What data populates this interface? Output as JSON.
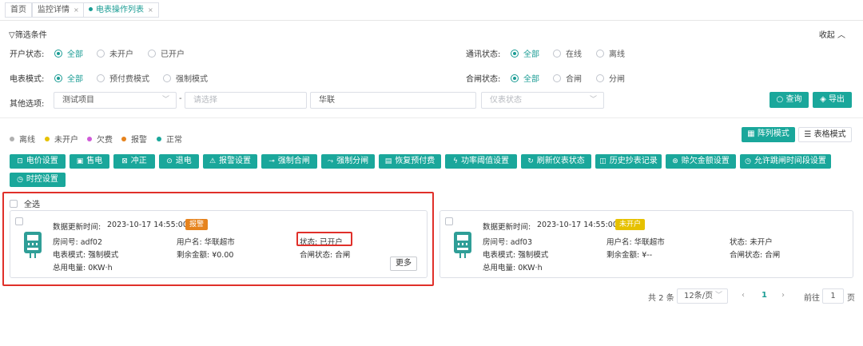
{
  "tabs": [
    {
      "label": "首页"
    },
    {
      "label": "监控详情"
    },
    {
      "label": "电表操作列表"
    }
  ],
  "filter": {
    "title": "筛选条件",
    "collapse_label": "收起",
    "open_status": {
      "label": "开户状态:",
      "options": [
        "全部",
        "未开户",
        "已开户"
      ],
      "selected": "全部"
    },
    "comm_status": {
      "label": "通讯状态:",
      "options": [
        "全部",
        "在线",
        "离线"
      ],
      "selected": "全部"
    },
    "meter_mode": {
      "label": "电表模式:",
      "options": [
        "全部",
        "预付费模式",
        "强制模式"
      ],
      "selected": "全部"
    },
    "switch_status": {
      "label": "合闸状态:",
      "options": [
        "全部",
        "合闸",
        "分闸"
      ],
      "selected": "全部"
    },
    "other": {
      "label": "其他选项:",
      "project": "测试项目",
      "dash": "-",
      "select_placeholder": "请选择",
      "keyword": "华联",
      "meter_status_placeholder": "仪表状态"
    },
    "query_label": "查询",
    "export_label": "导出"
  },
  "legend": [
    {
      "label": "离线",
      "color": "#b0b0b0"
    },
    {
      "label": "未开户",
      "color": "#e6c100"
    },
    {
      "label": "欠费",
      "color": "#d05ad8"
    },
    {
      "label": "报警",
      "color": "#e6831d"
    },
    {
      "label": "正常",
      "color": "#1aa79b"
    }
  ],
  "view_modes": {
    "grid": "阵列模式",
    "table": "表格模式"
  },
  "actions": [
    {
      "label": "电价设置",
      "icon": "⊡"
    },
    {
      "label": "售电",
      "icon": "▣"
    },
    {
      "label": "冲正",
      "icon": "⊠"
    },
    {
      "label": "退电",
      "icon": "⊙"
    },
    {
      "label": "报警设置",
      "icon": "⚠"
    },
    {
      "label": "强制合闸",
      "icon": "⊸"
    },
    {
      "label": "强制分闸",
      "icon": "⤳"
    },
    {
      "label": "恢复预付费",
      "icon": "▤"
    },
    {
      "label": "功率阈值设置",
      "icon": "ϟ"
    },
    {
      "label": "刷新仪表状态",
      "icon": "↻"
    },
    {
      "label": "历史抄表记录",
      "icon": "◫"
    },
    {
      "label": "赊欠金额设置",
      "icon": "⊛"
    },
    {
      "label": "允许跳闸时间段设置",
      "icon": "◷"
    },
    {
      "label": "时控设置",
      "icon": "◷"
    }
  ],
  "select_all_label": "全选",
  "cards": [
    {
      "update_label": "数据更新时间:",
      "update_time": "2023-10-17 14:55:00",
      "badge": "报警",
      "badge_color": "#e6831d",
      "room": "房间号: adf02",
      "user": "用户名: 华联超市",
      "status": "状态: 已开户",
      "mode": "电表模式: 强制模式",
      "balance": "剩余金额: ¥0.00",
      "switch": "合闸状态: 合闸",
      "energy": "总用电量: 0KW·h",
      "more": "更多"
    },
    {
      "update_label": "数据更新时间:",
      "update_time": "2023-10-17 14:55:00",
      "badge": "未开户",
      "badge_color": "#e6c100",
      "room": "房间号: adf03",
      "user": "用户名: 华联超市",
      "status": "状态: 未开户",
      "mode": "电表模式: 强制模式",
      "balance": "剩余金额: ¥--",
      "switch": "合闸状态: 合闸",
      "energy": "总用电量: 0KW·h"
    }
  ],
  "pagination": {
    "total": "共 2 条",
    "page_size": "12条/页",
    "current_page": "1",
    "goto_label": "前往",
    "goto_value": "1",
    "page_suffix": "页"
  }
}
